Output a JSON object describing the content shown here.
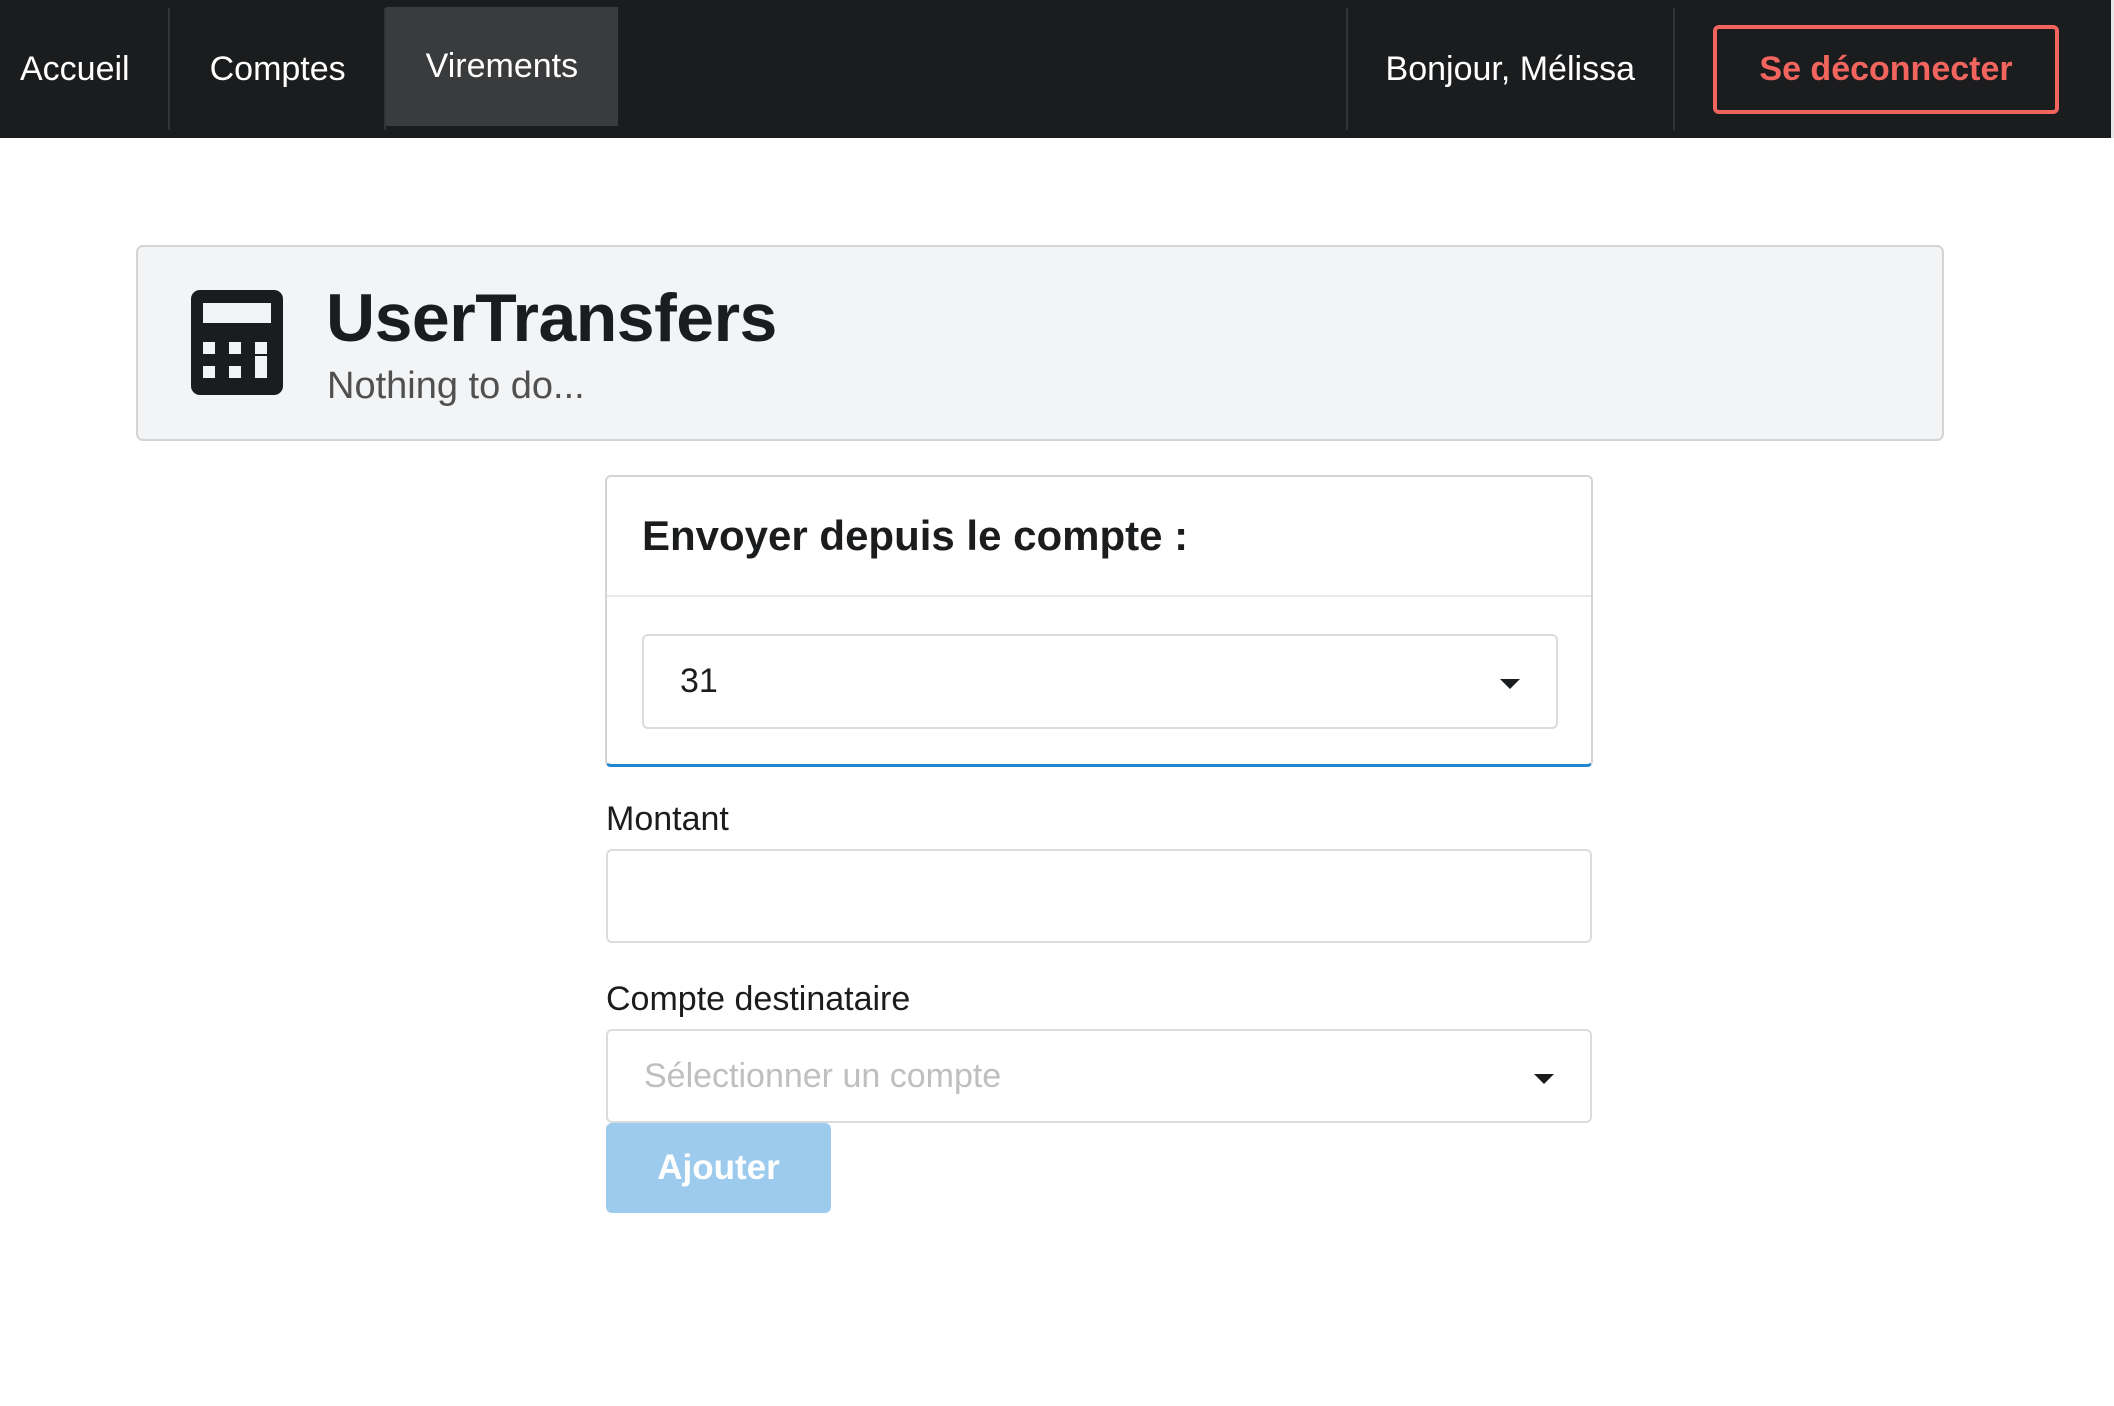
{
  "nav": {
    "items": [
      {
        "label": "Accueil"
      },
      {
        "label": "Comptes"
      },
      {
        "label": "Virements",
        "active": true
      }
    ],
    "greeting": "Bonjour, Mélissa",
    "logout_label": "Se déconnecter"
  },
  "header": {
    "icon": "calculator-icon",
    "title": "UserTransfers",
    "subtitle": "Nothing to do..."
  },
  "source_account": {
    "heading": "Envoyer depuis le compte :",
    "selected_value": "31"
  },
  "form": {
    "amount_label": "Montant",
    "amount_value": "",
    "destination_label": "Compte destinataire",
    "destination_placeholder": "Sélectionner un compte",
    "submit_label": "Ajouter"
  },
  "colors": {
    "menu_bg": "#1b1c1d",
    "active_item_bg": "#3a3b3c",
    "logout_accent": "#f2655f",
    "header_bg": "#f3f4f5",
    "card_accent": "#2185d0",
    "submit_disabled": "#9ccbee"
  }
}
